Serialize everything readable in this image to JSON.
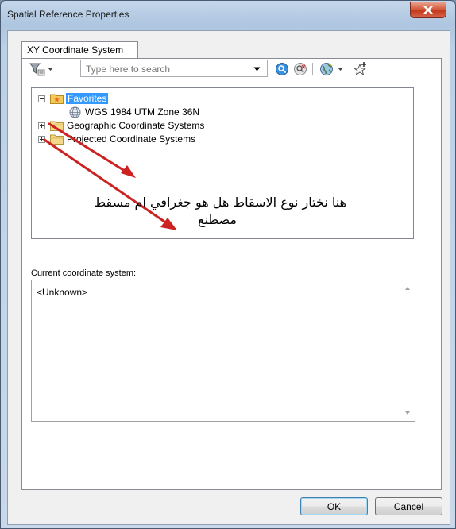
{
  "window": {
    "title": "Spatial Reference Properties",
    "close_glyph": "X"
  },
  "tabs": [
    {
      "label": "XY Coordinate System"
    }
  ],
  "toolbar": {
    "filter_icon": "filter-icon",
    "search_placeholder": "Type here to search",
    "dropdown_glyph": "▾"
  },
  "tree": {
    "items": [
      {
        "label": "Favorites",
        "icon": "folder-star-icon",
        "expanded": true,
        "selected": true
      },
      {
        "label": "WGS 1984 UTM Zone 36N",
        "icon": "globe-icon"
      },
      {
        "label": "Geographic Coordinate Systems",
        "icon": "folder-icon",
        "expanded": false
      },
      {
        "label": "Projected Coordinate Systems",
        "icon": "folder-icon",
        "expanded": false
      }
    ]
  },
  "annotation": {
    "line1": "هنا نختار نوع الاسقاط هل هو جغرافي ام مسقط",
    "line2": "مصطنع",
    "arrow_color": "#cc2222"
  },
  "current": {
    "label": "Current coordinate system:",
    "value": "<Unknown>"
  },
  "buttons": {
    "ok": "OK",
    "cancel": "Cancel"
  }
}
